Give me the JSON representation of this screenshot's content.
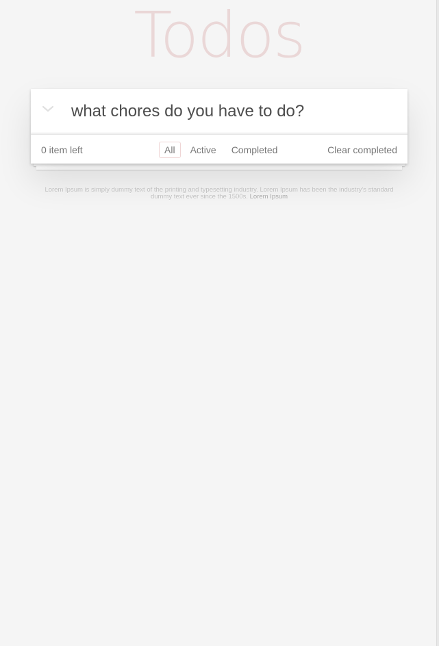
{
  "app": {
    "title": "Todos"
  },
  "header": {
    "toggle_icon": "chevron-down-icon",
    "new_todo_placeholder": "what chores do you have to do?",
    "new_todo_value": ""
  },
  "footer": {
    "count_text": "0 item left",
    "filters": [
      {
        "label": "All",
        "selected": true
      },
      {
        "label": "Active",
        "selected": false
      },
      {
        "label": "Completed",
        "selected": false
      }
    ],
    "clear_label": "Clear completed"
  },
  "info": {
    "text_line1": "Lorem Ipsum is simply dummy text of the printing and typesetting industry. Lorem Ipsum has been the industry's standard",
    "text_line2": "dummy text ever since the 1500s.",
    "link_label": "Lorem Ipsum"
  },
  "colors": {
    "background": "#f5f5f5",
    "title": "#af2f2f",
    "selected_filter_border": "#af2f2f"
  }
}
